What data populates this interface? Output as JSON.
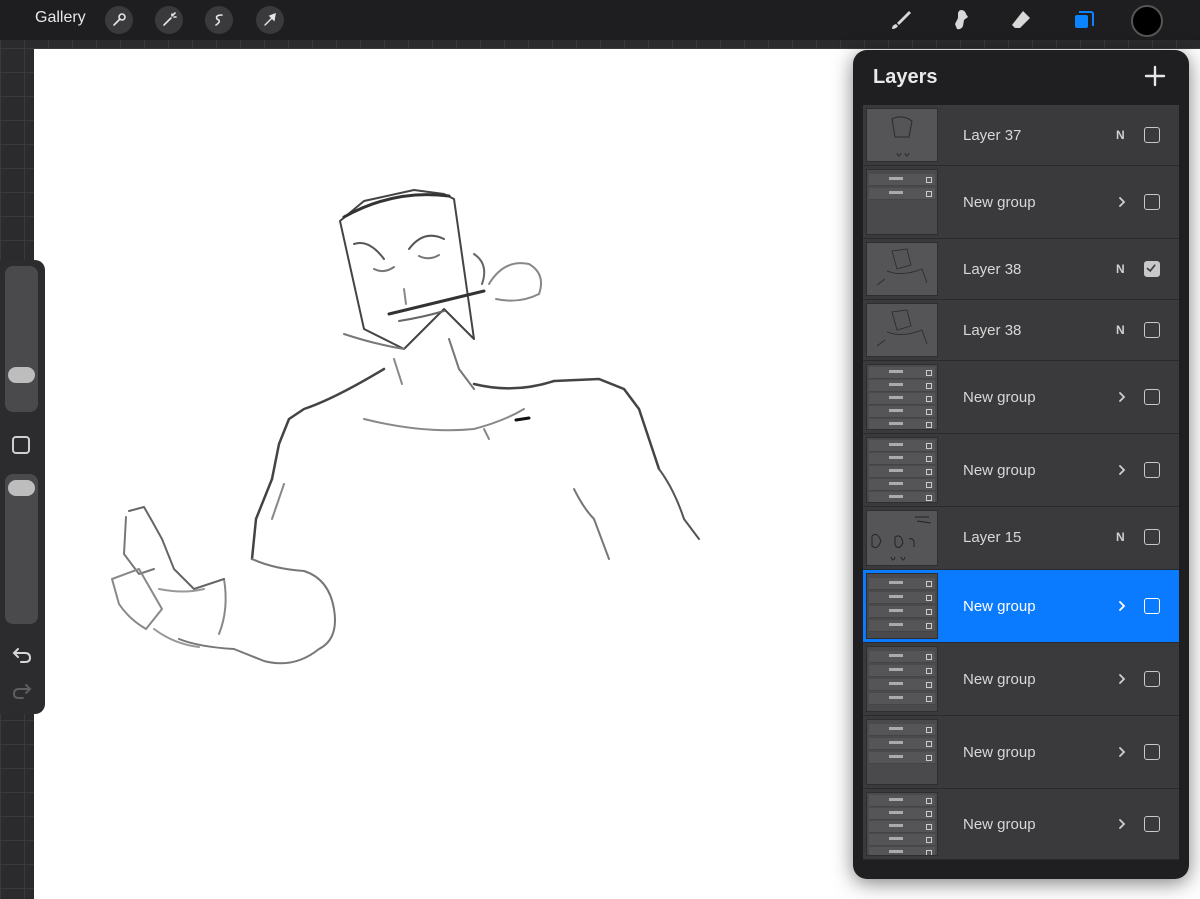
{
  "topbar": {
    "gallery_label": "Gallery",
    "left_tools": [
      "wrench-icon",
      "magic-wand-icon",
      "selection-icon",
      "transform-arrow-icon"
    ],
    "right_tools": [
      "brush-icon",
      "smudge-icon",
      "eraser-icon",
      "layers-icon"
    ],
    "active_tool_color": "#0a84ff",
    "current_color": "#000000"
  },
  "layers_panel": {
    "title": "Layers",
    "add_symbol": "+",
    "layers": [
      {
        "name": "Layer 37",
        "blend": "N",
        "visible": false,
        "group": false,
        "selected": false
      },
      {
        "name": "New group",
        "blend": "",
        "visible": false,
        "group": true,
        "selected": false
      },
      {
        "name": "Layer 38",
        "blend": "N",
        "visible": true,
        "group": false,
        "selected": false
      },
      {
        "name": "Layer 38",
        "blend": "N",
        "visible": false,
        "group": false,
        "selected": false
      },
      {
        "name": "New group",
        "blend": "",
        "visible": false,
        "group": true,
        "selected": false
      },
      {
        "name": "New group",
        "blend": "",
        "visible": false,
        "group": true,
        "selected": false
      },
      {
        "name": "Layer 15",
        "blend": "N",
        "visible": false,
        "group": false,
        "selected": false
      },
      {
        "name": "New group",
        "blend": "",
        "visible": false,
        "group": true,
        "selected": true
      },
      {
        "name": "New group",
        "blend": "",
        "visible": false,
        "group": true,
        "selected": false
      },
      {
        "name": "New group",
        "blend": "",
        "visible": false,
        "group": true,
        "selected": false
      },
      {
        "name": "New group",
        "blend": "",
        "visible": false,
        "group": true,
        "selected": false
      }
    ]
  },
  "sidebar": {
    "brush_size": 0.35,
    "brush_opacity": 0.02
  }
}
